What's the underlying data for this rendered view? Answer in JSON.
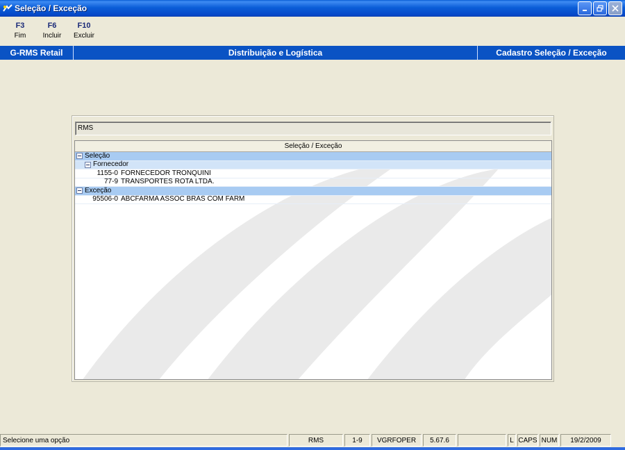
{
  "window": {
    "title": "Seleção / Exceção"
  },
  "toolbar": [
    {
      "key": "F3",
      "label": "Fim"
    },
    {
      "key": "F6",
      "label": "Incluir"
    },
    {
      "key": "F10",
      "label": "Excluir"
    }
  ],
  "header": {
    "left": "G-RMS Retail",
    "center": "Distribuição e Logística",
    "right": "Cadastro Seleção / Exceção"
  },
  "panel": {
    "field_value": "RMS",
    "column_header": "Seleção / Exceção",
    "groups": [
      {
        "label": "Seleção",
        "subgroups": [
          {
            "label": "Fornecedor",
            "items": [
              {
                "code": "1155-0",
                "name": "FORNECEDOR TRONQUINI"
              },
              {
                "code": "77-9",
                "name": "TRANSPORTES ROTA LTDA."
              }
            ]
          }
        ]
      },
      {
        "label": "Exceção",
        "items": [
          {
            "code": "95506-0",
            "name": "ABCFARMA ASSOC BRAS COM FARM"
          }
        ]
      }
    ]
  },
  "status": {
    "message": "Selecione uma opção",
    "system": "RMS",
    "range": "1-9",
    "program": "VGRFOPER",
    "version": "5.67.6",
    "blank": "",
    "lock": "L",
    "caps": "CAPS",
    "num": "NUM",
    "date": "19/2/2009"
  },
  "colors": {
    "titlebar": "#0b5ed8",
    "band": "#0a53c4",
    "group_row": "#a8cbf2",
    "subgroup_row": "#d2e4f8"
  }
}
